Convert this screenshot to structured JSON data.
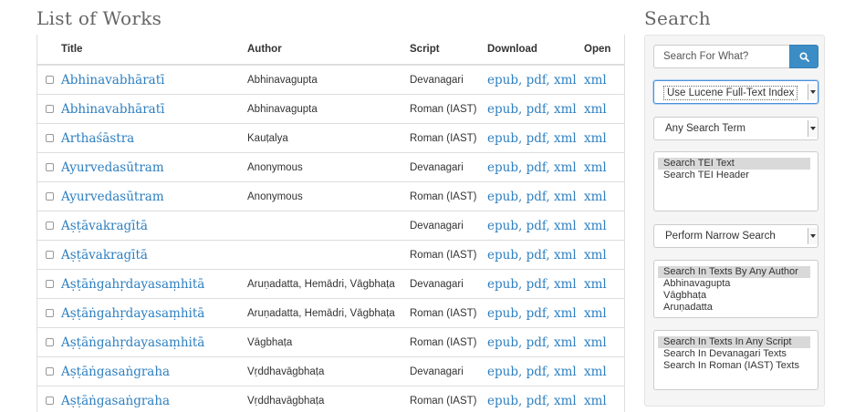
{
  "list_heading": "List of Works",
  "search_heading": "Search",
  "columns": {
    "title": "Title",
    "author": "Author",
    "script": "Script",
    "download": "Download",
    "open": "Open"
  },
  "download_links": {
    "epub": "epub",
    "pdf": "pdf",
    "xml": "xml"
  },
  "works": [
    {
      "title": "Abhinavabhāratī",
      "author": "Abhinavagupta",
      "script": "Devanagari",
      "open": "xml"
    },
    {
      "title": "Abhinavabhāratī",
      "author": "Abhinavagupta",
      "script": "Roman (IAST)",
      "open": "xml"
    },
    {
      "title": "Arthaśāstra",
      "author": "Kauṭalya",
      "script": "Roman (IAST)",
      "open": "xml"
    },
    {
      "title": "Ayurvedasūtram",
      "author": "Anonymous",
      "script": "Devanagari",
      "open": "xml"
    },
    {
      "title": "Ayurvedasūtram",
      "author": "Anonymous",
      "script": "Roman (IAST)",
      "open": "xml"
    },
    {
      "title": "Aṣṭāvakragītā",
      "author": "",
      "script": "Devanagari",
      "open": "xml"
    },
    {
      "title": "Aṣṭāvakragītā",
      "author": "",
      "script": "Roman (IAST)",
      "open": "xml"
    },
    {
      "title": "Aṣṭāṅgahṛdayasaṃhitā",
      "author": "Aruṇadatta, Hemādri, Vāgbhaṭa",
      "script": "Devanagari",
      "open": "xml"
    },
    {
      "title": "Aṣṭāṅgahṛdayasaṃhitā",
      "author": "Aruṇadatta, Hemādri, Vāgbhaṭa",
      "script": "Roman (IAST)",
      "open": "xml"
    },
    {
      "title": "Aṣṭāṅgahṛdayasaṃhitā",
      "author": "Vāgbhaṭa",
      "script": "Roman (IAST)",
      "open": "xml"
    },
    {
      "title": "Aṣṭāṅgasaṅgraha",
      "author": "Vṛddhavāgbhaṭa",
      "script": "Devanagari",
      "open": "xml"
    },
    {
      "title": "Aṣṭāṅgasaṅgraha",
      "author": "Vṛddhavāgbhaṭa",
      "script": "Roman (IAST)",
      "open": "xml"
    }
  ],
  "search": {
    "placeholder": "Search For What?",
    "button_icon": "search-icon",
    "index_select": "Use Lucene Full-Text Index",
    "term_select": "Any Search Term",
    "fields": [
      "Search TEI Text",
      "Search TEI Header"
    ],
    "narrow_select": "Perform Narrow Search",
    "authors": [
      "Search In Texts By Any Author",
      "Abhinavagupta",
      "Vāgbhaṭa",
      "Aruṇadatta"
    ],
    "scripts": [
      "Search In Texts In Any Script",
      "Search In Devanagari Texts",
      "Search In Roman (IAST) Texts"
    ]
  },
  "colors": {
    "link": "#2d7fc0",
    "search_button": "#3c8dc5",
    "panel_bg": "#f5f5f5"
  }
}
